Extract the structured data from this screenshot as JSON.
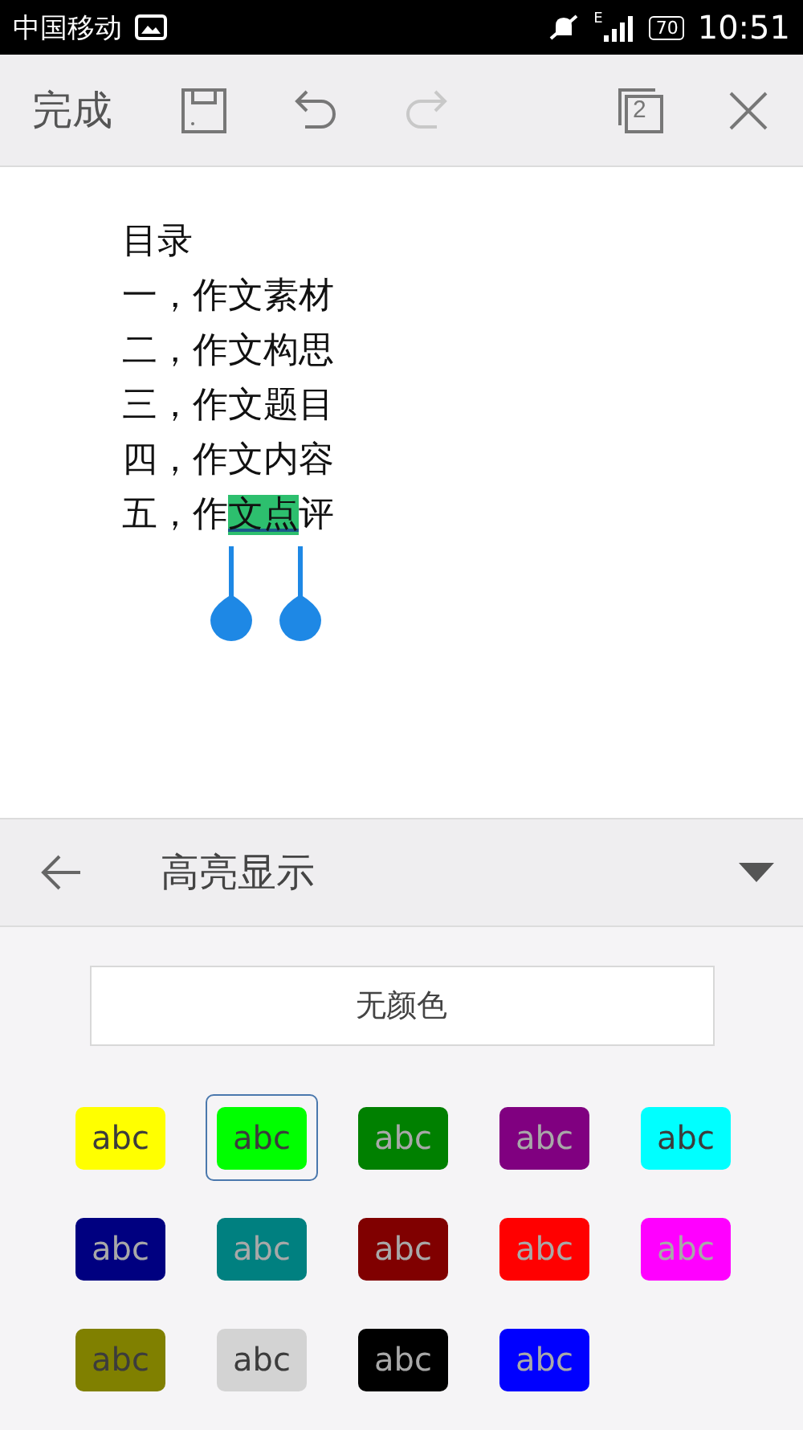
{
  "status_bar": {
    "carrier": "中国移动",
    "network": "E",
    "battery": "70",
    "time": "10:51"
  },
  "toolbar": {
    "done": "完成",
    "undo_disabled": false,
    "redo_disabled": true,
    "page_count": "2"
  },
  "document": {
    "lines": [
      [
        {
          "text": "目录",
          "selected": false
        }
      ],
      [
        {
          "text": "一，作文素材",
          "selected": false
        }
      ],
      [
        {
          "text": "二，作文构思",
          "selected": false
        }
      ],
      [
        {
          "text": "三，作文题目",
          "selected": false
        }
      ],
      [
        {
          "text": "四，作文内容",
          "selected": false
        }
      ],
      [
        {
          "text": "五，作",
          "selected": false
        },
        {
          "text": "文点",
          "selected": true
        },
        {
          "text": "评",
          "selected": false
        }
      ]
    ]
  },
  "panel": {
    "title": "高亮显示",
    "no_color": "无颜色",
    "swatches": [
      {
        "label": "abc",
        "color": "#ffff00",
        "selected": false
      },
      {
        "label": "abc",
        "color": "#00ff00",
        "selected": true
      },
      {
        "label": "abc",
        "color": "#008000",
        "selected": false
      },
      {
        "label": "abc",
        "color": "#800080",
        "selected": false
      },
      {
        "label": "abc",
        "color": "#00ffff",
        "selected": false
      },
      {
        "label": "abc",
        "color": "#000080",
        "selected": false
      },
      {
        "label": "abc",
        "color": "#008080",
        "selected": false
      },
      {
        "label": "abc",
        "color": "#800000",
        "selected": false
      },
      {
        "label": "abc",
        "color": "#ff0000",
        "selected": false
      },
      {
        "label": "abc",
        "color": "#ff00ff",
        "selected": false
      },
      {
        "label": "abc",
        "color": "#808000",
        "selected": false
      },
      {
        "label": "abc",
        "color": "#d3d3d3",
        "selected": false
      },
      {
        "label": "abc",
        "color": "#000000",
        "selected": false
      },
      {
        "label": "abc",
        "color": "#0000ff",
        "selected": false
      }
    ]
  }
}
